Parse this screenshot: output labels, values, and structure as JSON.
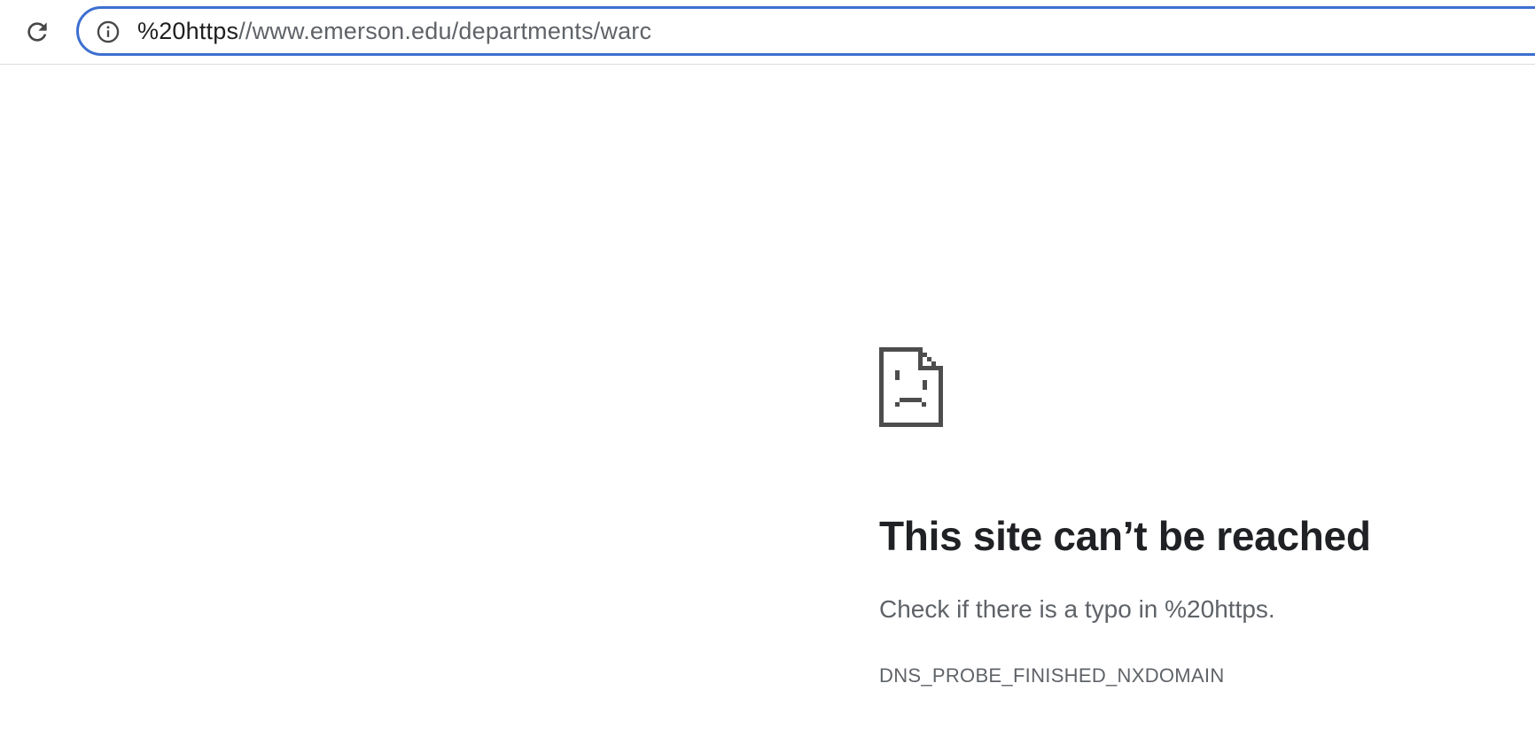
{
  "toolbar": {
    "reload_icon": "reload-icon",
    "omnibox": {
      "info_icon": "info-icon",
      "url_host": "%20https",
      "url_rest": "//www.emerson.edu/departments/warc",
      "accent_color": "#3c6fd1"
    }
  },
  "error": {
    "icon": "sad-page-icon",
    "title": "This site can’t be reached",
    "suggestion": "Check if there is a typo in %20https.",
    "code": "DNS_PROBE_FINISHED_NXDOMAIN"
  }
}
